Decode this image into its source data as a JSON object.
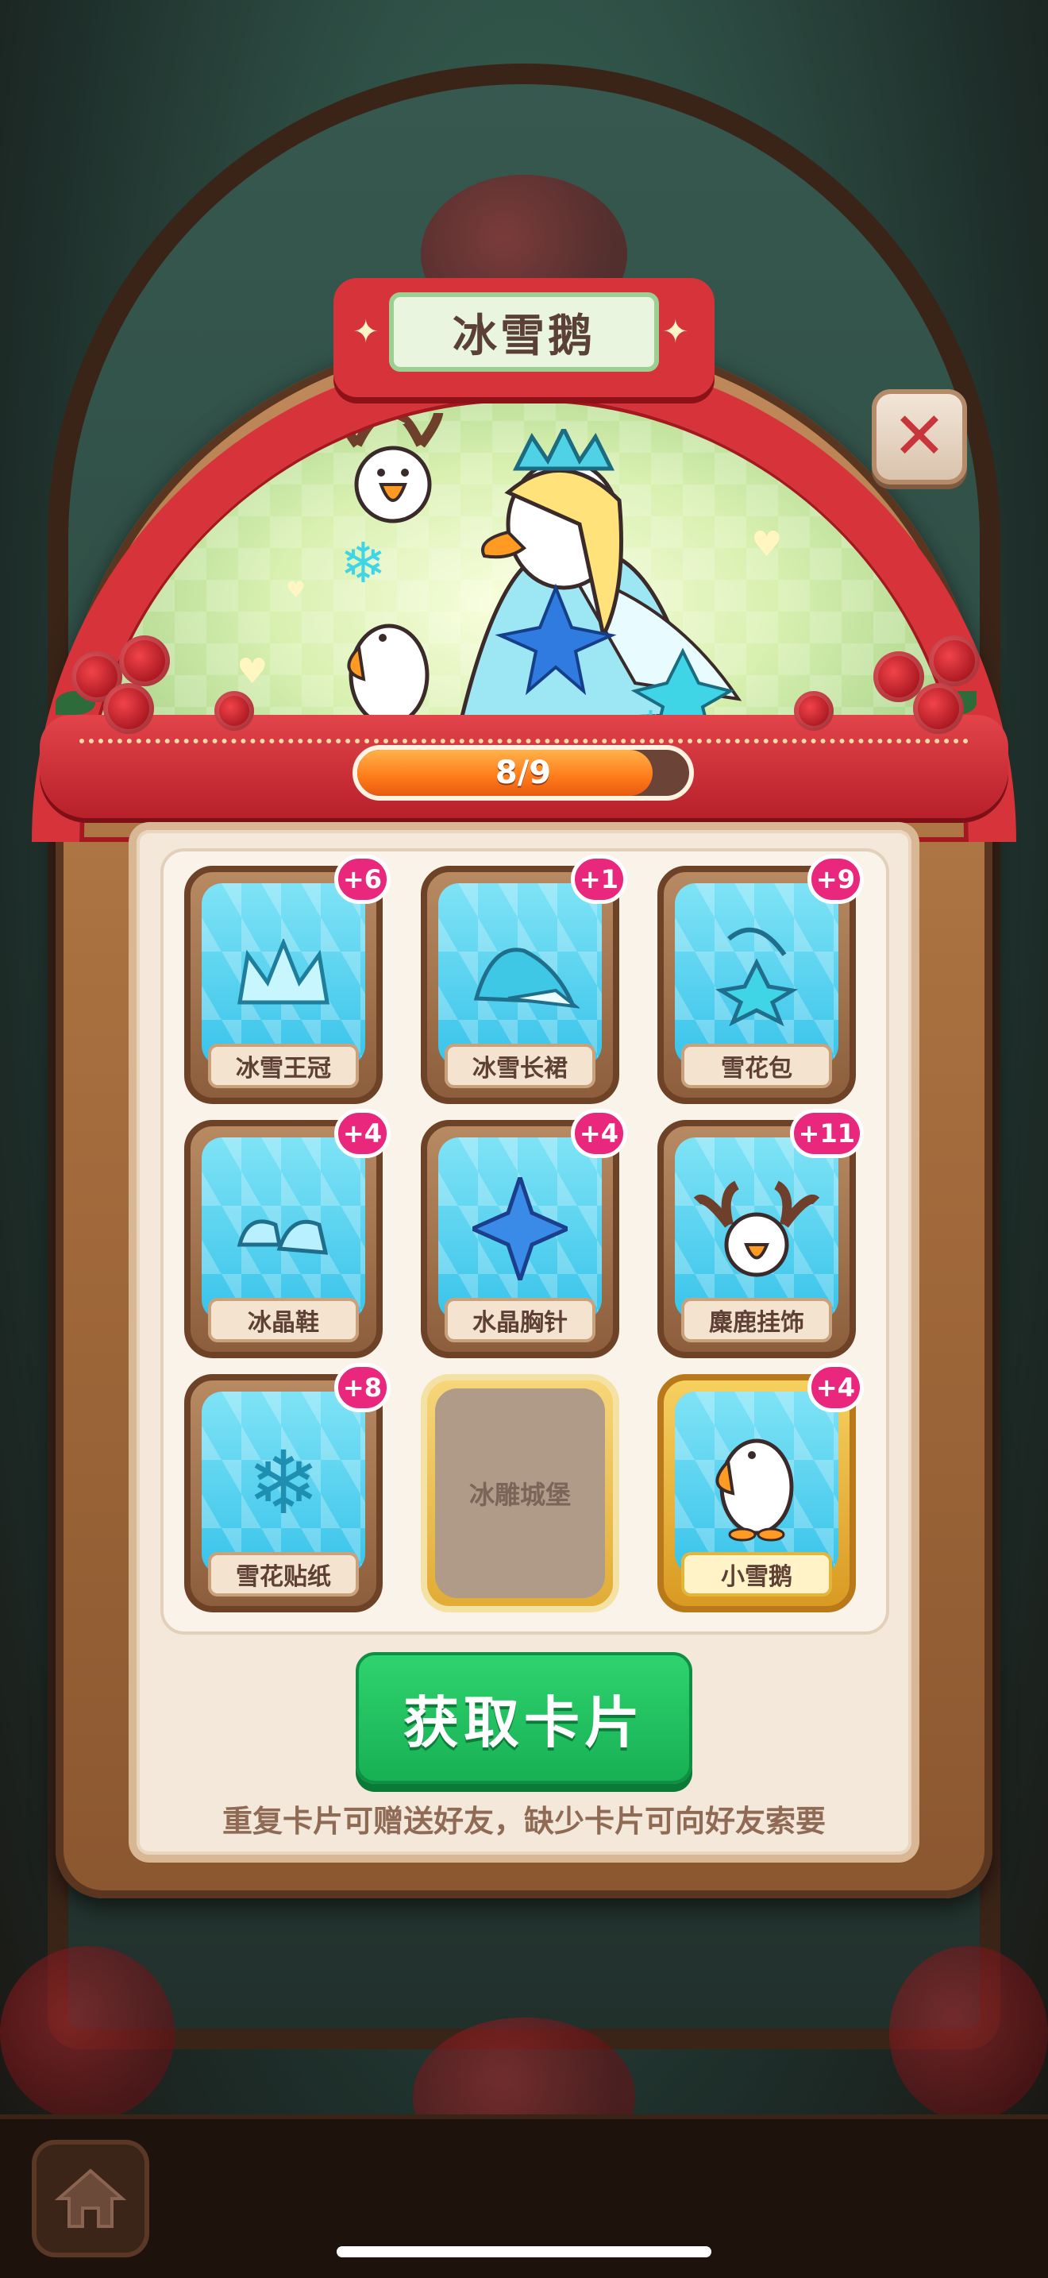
{
  "album": {
    "title": "冰雪鹅",
    "progress_text": "8/9",
    "progress": 0.889
  },
  "cards": [
    {
      "label": "冰雪王冠",
      "badge": "+6",
      "icon": "crown-icon",
      "collected": true
    },
    {
      "label": "冰雪长裙",
      "badge": "+1",
      "icon": "dress-icon",
      "collected": true
    },
    {
      "label": "雪花包",
      "badge": "+9",
      "icon": "snowflake-bag-icon",
      "collected": true
    },
    {
      "label": "冰晶鞋",
      "badge": "+4",
      "icon": "crystal-shoes-icon",
      "collected": true
    },
    {
      "label": "水晶胸针",
      "badge": "+4",
      "icon": "crystal-brooch-icon",
      "collected": true
    },
    {
      "label": "麋鹿挂饰",
      "badge": "+11",
      "icon": "reindeer-icon",
      "collected": true
    },
    {
      "label": "雪花贴纸",
      "badge": "+8",
      "icon": "snowflake-icon",
      "collected": true
    },
    {
      "label": "冰雕城堡",
      "badge": "",
      "icon": "",
      "collected": false
    },
    {
      "label": "小雪鹅",
      "badge": "+4",
      "icon": "snow-goose-icon",
      "collected": true,
      "rare": true
    }
  ],
  "actions": {
    "get_cards": "获取卡片"
  },
  "hint": "重复卡片可赠送好友，缺少卡片可向好友索要",
  "colors": {
    "ribbon": "#d6343a",
    "badge": "#e8277d",
    "button": "#1fc260",
    "progress": "#ff8a24"
  }
}
